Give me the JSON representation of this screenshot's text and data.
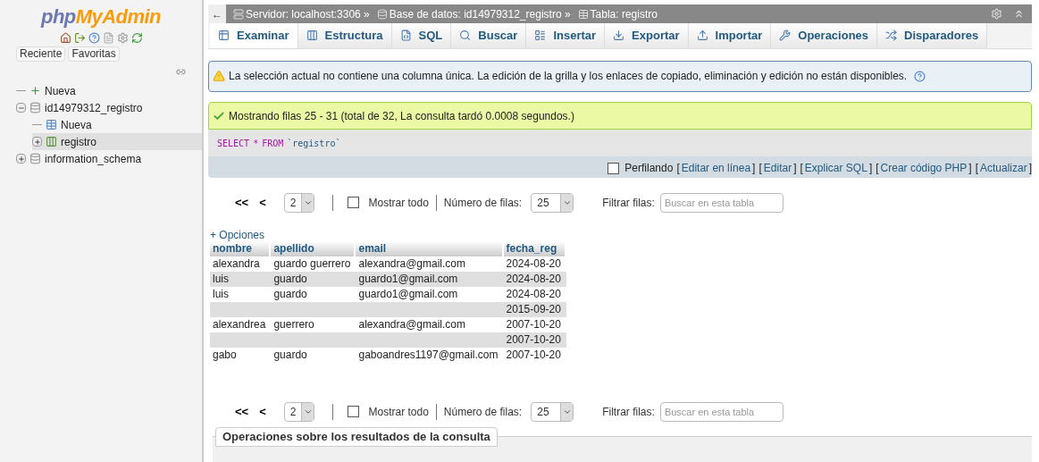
{
  "sidebar": {
    "logo_php": "php",
    "logo_rest": "MyAdmin",
    "buttons": [
      "Reciente",
      "Favoritas"
    ],
    "tree": [
      {
        "label": "Nueva",
        "kind": "new"
      },
      {
        "label": "id14979312_registro",
        "kind": "db",
        "expanded": true,
        "children": [
          {
            "label": "Nueva",
            "kind": "newtable"
          },
          {
            "label": "registro",
            "kind": "table",
            "selected": true,
            "expanded": false
          }
        ]
      },
      {
        "label": "information_schema",
        "kind": "db",
        "expanded": false
      }
    ]
  },
  "breadcrumb": {
    "back": "←",
    "parts": [
      "Servidor: localhost:3306 »",
      "Base de datos: id14979312_registro »",
      "Tabla: registro"
    ]
  },
  "tabs": [
    {
      "label": "Examinar",
      "selected": true
    },
    {
      "label": "Estructura",
      "selected": false
    },
    {
      "label": "SQL",
      "selected": false
    },
    {
      "label": "Buscar",
      "selected": false
    },
    {
      "label": "Insertar",
      "selected": false
    },
    {
      "label": "Exportar",
      "selected": false
    },
    {
      "label": "Importar",
      "selected": false
    },
    {
      "label": "Operaciones",
      "selected": false
    },
    {
      "label": "Disparadores",
      "selected": false
    }
  ],
  "warning": "La selección actual no contiene una columna única. La edición de la grilla y los enlaces de copiado, eliminación y edición no están disponibles.",
  "success": "Mostrando filas 25 - 31 (total de 32, La consulta tardó 0.0008 segundos.)",
  "sql": [
    "SELECT",
    "*",
    "FROM",
    "`registro`"
  ],
  "query_links": {
    "profiling": {
      "label": "Perfilando",
      "checked": false
    },
    "links": [
      {
        "open": "[",
        "label": "Editar en línea",
        "close": "]"
      },
      {
        "open": "[",
        "label": "Editar",
        "close": "]"
      },
      {
        "open": "[",
        "label": "Explicar SQL",
        "close": "]"
      },
      {
        "open": "[",
        "label": "Crear código PHP",
        "close": "]"
      },
      {
        "open": "[",
        "label": "Actualizar",
        "close": "]"
      }
    ]
  },
  "pagers": [
    {
      "first": "<<",
      "prev": "<",
      "page": "2",
      "show_all": {
        "label": "Mostrar todo",
        "checked": false
      },
      "rows_label": "Número de filas:",
      "rows": "25",
      "filter_label": "Filtrar filas:",
      "placeholder": "Buscar en esta tabla"
    },
    {
      "first": "<<",
      "prev": "<",
      "page": "2",
      "show_all": {
        "label": "Mostrar todo",
        "checked": false
      },
      "rows_label": "Número de filas:",
      "rows": "25",
      "filter_label": "Filtrar filas:",
      "placeholder": "Buscar en esta tabla"
    }
  ],
  "options_link": "+ Opciones",
  "table": {
    "columns": [
      "nombre",
      "apellido",
      "email",
      "fecha_reg"
    ],
    "rows": [
      [
        "alexandra",
        "guardo guerrero",
        "alexandra@gmail.com",
        "2024-08-20"
      ],
      [
        "luis",
        "guardo",
        "guardo1@gmail.com",
        "2024-08-20"
      ],
      [
        "luis",
        "guardo",
        "guardo1@gmail.com",
        "2024-08-20"
      ],
      [
        "",
        "",
        "",
        "2015-09-20"
      ],
      [
        "alexandrea",
        "guerrero",
        "alexandra@gmail.com",
        "2007-10-20"
      ],
      [
        "",
        "",
        "",
        "2007-10-20"
      ],
      [
        "gabo",
        "guardo",
        "gaboandres1197@gmail.com",
        "2007-10-20"
      ]
    ]
  },
  "results_ops": "Operaciones sobre los resultados de la consulta"
}
